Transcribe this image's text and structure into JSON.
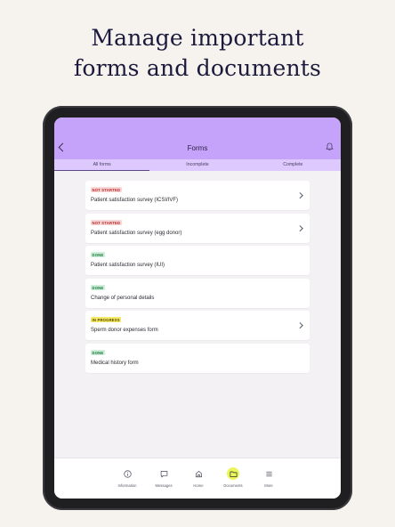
{
  "headline": {
    "line1": "Manage important",
    "line2": "forms and documents"
  },
  "appbar": {
    "title": "Forms"
  },
  "tabs": [
    {
      "label": "All forms",
      "active": true
    },
    {
      "label": "Incomplete",
      "active": false
    },
    {
      "label": "Complete",
      "active": false
    }
  ],
  "forms": [
    {
      "status": "NOT STARTED",
      "title": "Patient satisfaction survey (ICSI/IVF)"
    },
    {
      "status": "NOT STARTED",
      "title": "Patient satisfaction survey (egg donor)"
    },
    {
      "status": "DONE",
      "title": "Patient satisfaction survey (IUI)"
    },
    {
      "status": "DONE",
      "title": "Change of personal details"
    },
    {
      "status": "IN PROGRESS",
      "title": "Sperm donor expenses form"
    },
    {
      "status": "DONE",
      "title": "Medical history form"
    }
  ],
  "bottom_nav": [
    {
      "label": "Information",
      "icon": "info-icon"
    },
    {
      "label": "Messages",
      "icon": "message-icon"
    },
    {
      "label": "Home",
      "icon": "home-icon"
    },
    {
      "label": "Documents",
      "icon": "folder-icon",
      "active": true
    },
    {
      "label": "More",
      "icon": "menu-icon"
    }
  ],
  "colors": {
    "appbar": "#c6a3fb",
    "tabs": "#ddc9fd",
    "active_nav": "#e9f75c",
    "not_started": "#b82a2a",
    "done": "#1c7a3e",
    "in_progress": "#f6ea6a"
  }
}
